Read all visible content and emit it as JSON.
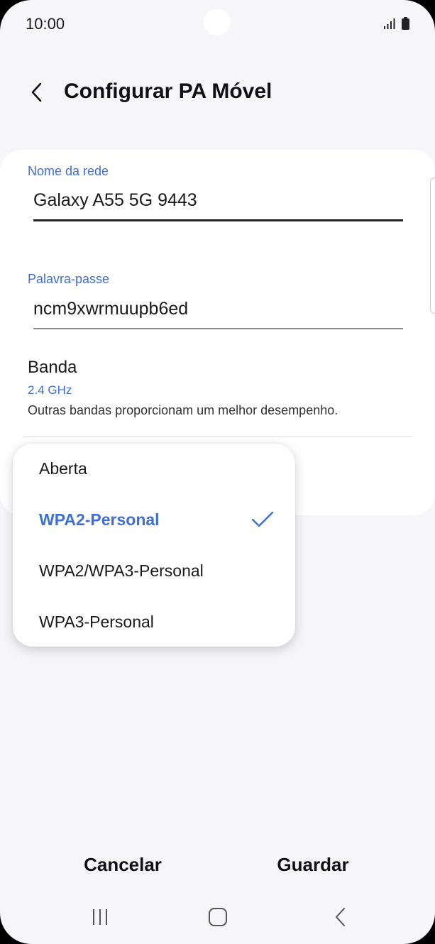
{
  "status": {
    "time": "10:00"
  },
  "header": {
    "title": "Configurar PA Móvel"
  },
  "network_name": {
    "label": "Nome da rede",
    "value": "Galaxy A55 5G 9443"
  },
  "password": {
    "label": "Palavra-passe",
    "value": "ncm9xwrmuupb6ed"
  },
  "band": {
    "title": "Banda",
    "value": "2.4 GHz",
    "description": "Outras bandas proporcionam um melhor desempenho."
  },
  "security_menu": {
    "items": [
      {
        "label": "Aberta",
        "selected": false
      },
      {
        "label": "WPA2-Personal",
        "selected": true
      },
      {
        "label": "WPA2/WPA3-Personal",
        "selected": false
      },
      {
        "label": "WPA3-Personal",
        "selected": false
      }
    ]
  },
  "actions": {
    "cancel_label": "Cancelar",
    "save_label": "Guardar"
  },
  "colors": {
    "accent": "#3e6fd1",
    "background": "#f6f6f8",
    "card": "#ffffff"
  },
  "icons": {
    "back": "chevron-left-icon",
    "check": "check-icon",
    "signal": "signal-icon",
    "battery": "battery-icon",
    "nav_recents": "recent-apps-icon",
    "nav_home": "home-icon",
    "nav_back": "back-icon"
  }
}
